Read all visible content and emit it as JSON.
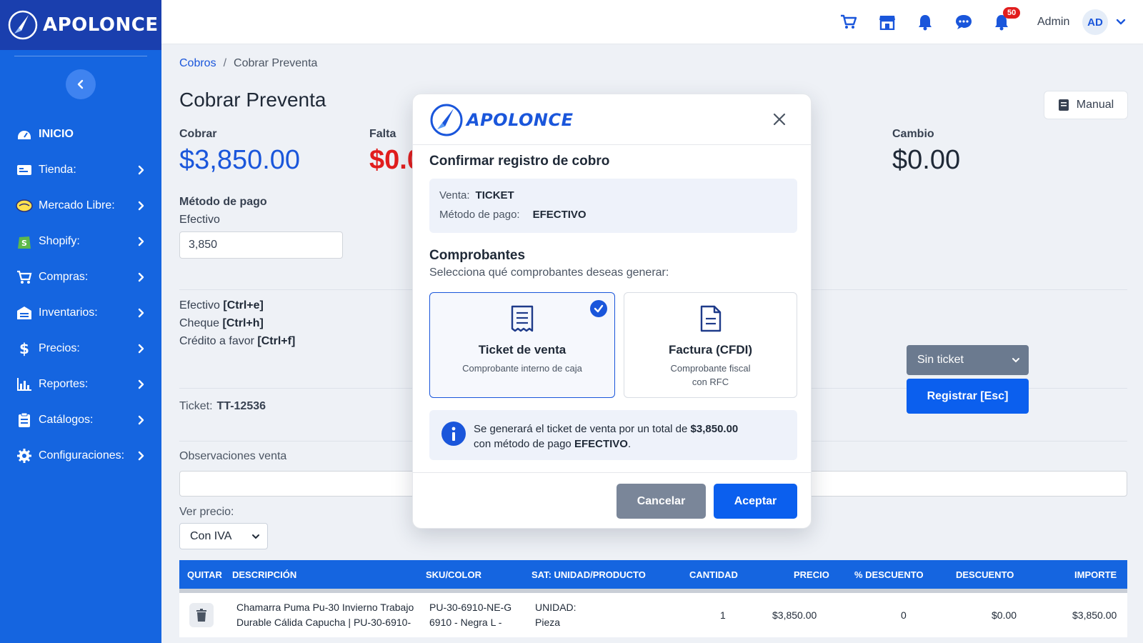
{
  "brand": {
    "name": "APOLONCE"
  },
  "sidebar": {
    "items": [
      {
        "label": "INICIO"
      },
      {
        "label": "Tienda:"
      },
      {
        "label": "Mercado Libre:"
      },
      {
        "label": "Shopify:"
      },
      {
        "label": "Compras:"
      },
      {
        "label": "Inventarios:"
      },
      {
        "label": "Precios:"
      },
      {
        "label": "Reportes:"
      },
      {
        "label": "Catálogos:"
      },
      {
        "label": "Configuraciones:"
      }
    ]
  },
  "topbar": {
    "notifications_badge": "50",
    "user_label": "Admin",
    "avatar_initials": "AD"
  },
  "breadcrumb": {
    "parent": "Cobros",
    "separator": "/",
    "current": "Cobrar Preventa"
  },
  "page": {
    "title": "Cobrar Preventa",
    "manual_label": "Manual",
    "cobrar_label": "Cobrar",
    "cobrar_value": "$3,850.00",
    "falta_label": "Falta",
    "falta_value": "$0.0",
    "cambio_label": "Cambio",
    "cambio_value": "$0.00",
    "metodo_label": "Método de pago",
    "efectivo_label": "Efectivo",
    "amount_value": "3,850",
    "shortcuts": [
      {
        "label": "Efectivo",
        "key": "[Ctrl+e]"
      },
      {
        "label": "Cheque",
        "key": "[Ctrl+h]"
      },
      {
        "label": "Crédito a favor",
        "key": "[Ctrl+f]"
      }
    ],
    "ticket_label": "Ticket:",
    "ticket_value": "TT-12536",
    "observaciones_label": "Observaciones venta",
    "ver_precio_label": "Ver precio:",
    "ver_precio_value": "Con IVA",
    "sin_ticket_value": "Sin ticket",
    "registrar_label": "Registrar [Esc]"
  },
  "table": {
    "headers": [
      "QUITAR",
      "DESCRIPCIÓN",
      "SKU/COLOR",
      "SAT: UNIDAD/PRODUCTO",
      "CANTIDAD",
      "PRECIO",
      "% DESCUENTO",
      "DESCUENTO",
      "IMPORTE"
    ],
    "rows": [
      {
        "descripcion_1": "Chamarra Puma Pu-30 Invierno Trabajo",
        "descripcion_2": "Durable Cálida Capucha | PU-30-6910-",
        "sku_1": "PU-30-6910-NE-G",
        "sku_2": "6910 - Negra L -",
        "sat_1": "UNIDAD:",
        "sat_2": "Pieza",
        "cantidad": "1",
        "precio": "$3,850.00",
        "pct_descuento": "0",
        "descuento": "$0.00",
        "importe": "$3,850.00"
      }
    ]
  },
  "modal": {
    "brand": "APOLONCE",
    "title": "Confirmar registro de cobro",
    "venta_label": "Venta:",
    "venta_value": "TICKET",
    "metodo_label": "Método de pago:",
    "metodo_value": "EFECTIVO",
    "comprobantes_title": "Comprobantes",
    "comprobantes_sub": "Selecciona qué comprobantes deseas generar:",
    "card_ticket_title": "Ticket de venta",
    "card_ticket_sub": "Comprobante interno de caja",
    "card_factura_title": "Factura (CFDI)",
    "card_factura_sub_1": "Comprobante fiscal",
    "card_factura_sub_2": "con RFC",
    "note_prefix": "Se generará el ticket de venta por un total de",
    "note_amount": "$3,850.00",
    "note_line2_prefix": "con método de pago",
    "note_method": "EFECTIVO",
    "cancel_label": "Cancelar",
    "accept_label": "Aceptar"
  },
  "colors": {
    "sidebar": "#1565e0",
    "primary": "#0b5fee",
    "danger": "#e11d1d",
    "muted_button": "#7a8699"
  }
}
